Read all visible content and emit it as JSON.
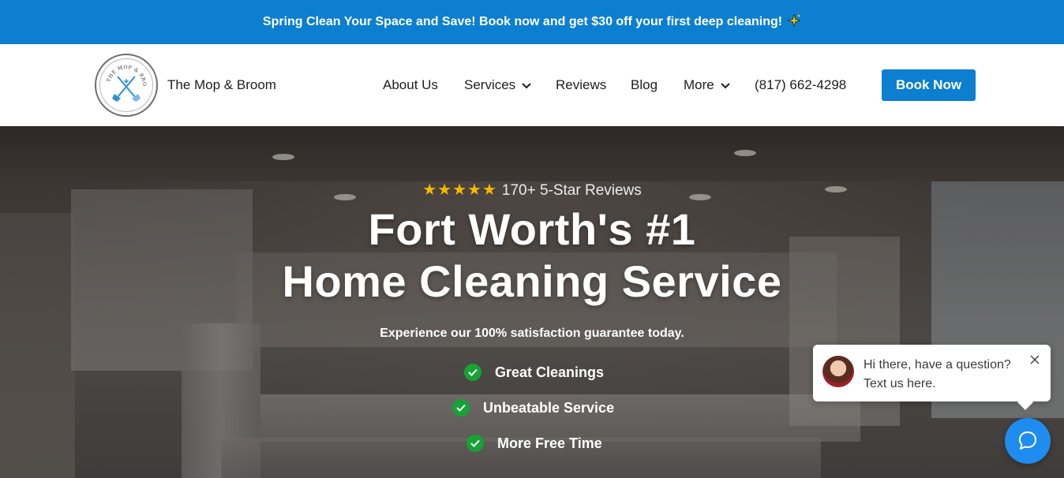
{
  "promo": {
    "text": "Spring Clean Your Space and Save! Book now and get $30 off your first deep cleaning!",
    "icon": "sparkles-icon"
  },
  "header": {
    "brand": "The Mop & Broom",
    "logo_text": "THE MOP & BROOM",
    "nav": {
      "about": "About Us",
      "services": "Services",
      "reviews": "Reviews",
      "blog": "Blog",
      "more": "More",
      "phone": "(817) 662-4298"
    },
    "cta": "Book Now"
  },
  "hero": {
    "stars": "★★★★★",
    "rating_text": "170+ 5-Star Reviews",
    "headline_line1": "Fort Worth's #1",
    "headline_line2": "Home Cleaning Service",
    "subhead": "Experience our 100% satisfaction guarantee today.",
    "features": [
      "Great Cleanings",
      "Unbeatable Service",
      "More Free Time"
    ]
  },
  "chat": {
    "line1": "Hi there, have a question?",
    "line2": "Text us here."
  },
  "colors": {
    "accent": "#0c7fd0",
    "star": "#f5b800",
    "check": "#16a335",
    "chat_fab": "#1f8cf0"
  }
}
